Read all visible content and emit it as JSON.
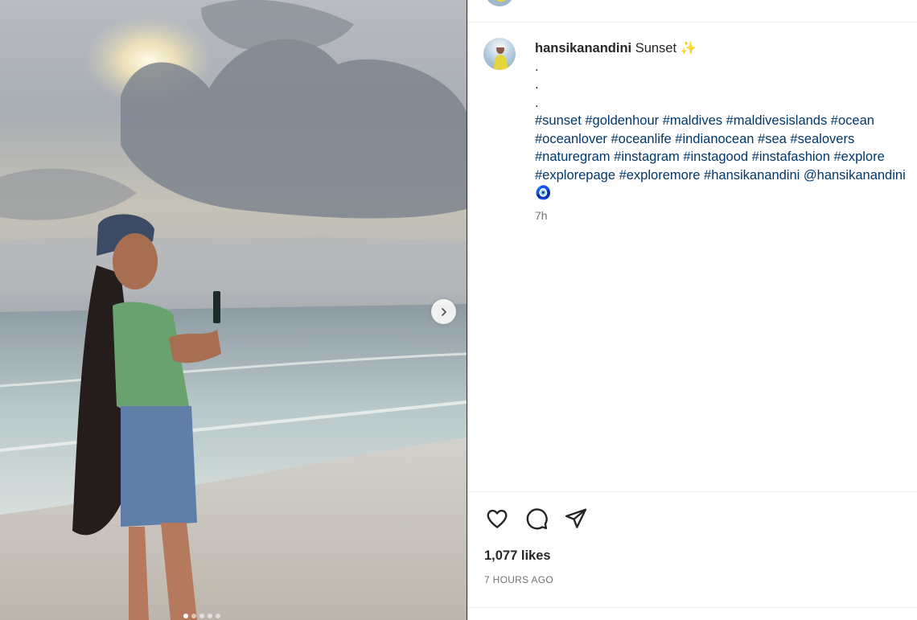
{
  "post": {
    "username": "hansikanandini",
    "caption_title": "Sunset ✨",
    "caption_dots": [
      ".",
      ".",
      "."
    ],
    "hashtag_lines": [
      "#sunset #goldenhour #maldives #maldivesislands #ocean",
      "#oceanlover #oceanlife #indianocean #sea #sealovers",
      "#naturegram #instagram #instagood #instafashion #explore",
      "#explorepage #exploremore #hansikanandini @hansikanandini"
    ],
    "emoji": "🧿",
    "time": "7h",
    "likes": "1,077 likes",
    "posted_ago": "7 HOURS AGO"
  },
  "carousel": {
    "slide_count": 5,
    "active_index": 0
  },
  "icons": {
    "like": "heart-icon",
    "comment": "comment-icon",
    "share": "paper-plane-icon",
    "next": "chevron-right-icon"
  },
  "colors": {
    "text": "#262626",
    "hashtag": "#00376b",
    "muted": "#737373"
  }
}
